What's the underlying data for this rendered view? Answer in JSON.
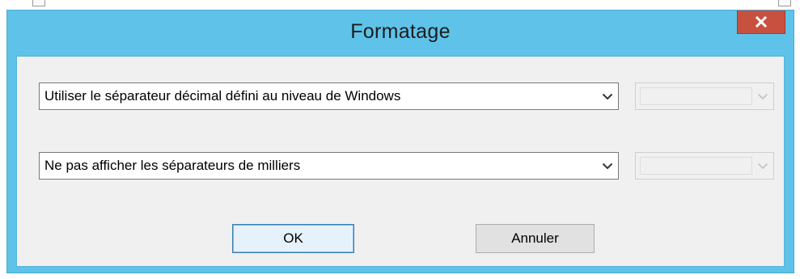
{
  "window": {
    "title": "Formatage",
    "close_icon": "close-icon"
  },
  "decimal_separator": {
    "selected": "Utiliser le séparateur décimal défini au niveau de Windows",
    "custom_value": ""
  },
  "thousands_separator": {
    "selected": "Ne pas afficher les séparateurs de milliers",
    "custom_value": ""
  },
  "buttons": {
    "ok_label": "OK",
    "cancel_label": "Annuler"
  },
  "colors": {
    "titlebar": "#5ec2e9",
    "close_button": "#c7503f",
    "client_area": "#f0f0f0"
  }
}
